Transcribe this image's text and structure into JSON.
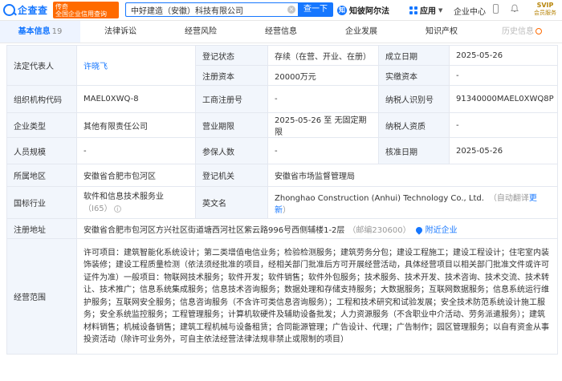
{
  "header": {
    "logo_text": "企查查",
    "brand_line1": "传奇",
    "brand_line2": "全国企业信用查询",
    "search_value": "中好建造（安徽）科技有限公司",
    "search_button": "查一下",
    "zhi_label": "知彼阿尔法",
    "app_label": "应用",
    "center_label": "企业中心",
    "svip_line1": "SVIP",
    "svip_line2": "会员服务"
  },
  "tabs": [
    {
      "label": "基本信息",
      "count": "19"
    },
    {
      "label": "法律诉讼"
    },
    {
      "label": "经营风险"
    },
    {
      "label": "经营信息"
    },
    {
      "label": "企业发展"
    },
    {
      "label": "知识产权"
    },
    {
      "label": "历史信息"
    }
  ],
  "info": {
    "legal_rep_label": "法定代表人",
    "legal_rep_value": "许晓飞",
    "reg_status_label": "登记状态",
    "reg_status_value": "存续（在营、开业、在册）",
    "est_date_label": "成立日期",
    "est_date_value": "2025-05-26",
    "reg_capital_label": "注册资本",
    "reg_capital_value": "20000万元",
    "paid_capital_label": "实缴资本",
    "paid_capital_value": "-",
    "org_code_label": "组织机构代码",
    "org_code_value": "MAEL0XWQ-8",
    "biz_reg_no_label": "工商注册号",
    "biz_reg_no_value": "-",
    "taxpayer_id_label": "纳税人识别号",
    "taxpayer_id_value": "91340000MAEL0XWQ8P",
    "company_type_label": "企业类型",
    "company_type_value": "其他有限责任公司",
    "biz_term_label": "营业期限",
    "biz_term_value": "2025-05-26 至 无固定期限",
    "taxpayer_qual_label": "纳税人资质",
    "taxpayer_qual_value": "-",
    "staff_size_label": "人员规模",
    "staff_size_value": "-",
    "insured_label": "参保人数",
    "insured_value": "-",
    "approval_date_label": "核准日期",
    "approval_date_value": "2025-05-26",
    "region_label": "所属地区",
    "region_value": "安徽省合肥市包河区",
    "reg_authority_label": "登记机关",
    "reg_authority_value": "安徽省市场监督管理局",
    "industry_label": "国标行业",
    "industry_value": "软件和信息技术服务业",
    "industry_code": "（I65）",
    "en_name_label": "英文名",
    "en_name_value": "Zhonghao Construction (Anhui) Technology Co., Ltd.",
    "en_name_auto": "（自动翻译",
    "en_name_refresh": "更新",
    "en_name_close": "）",
    "address_label": "注册地址",
    "address_value": "安徽省合肥市包河区方兴社区街道塘西河社区紫云路996号西侧辅楼1-2层",
    "address_zip": "（邮编230600）",
    "address_nearby": "附近企业",
    "scope_label": "经营范围",
    "scope_value": "许可项目：建筑智能化系统设计；第二类增值电信业务；检验检测服务；建筑劳务分包；建设工程施工；建设工程设计；住宅室内装饰装修；建设工程质量检测（依法须经批准的项目，经相关部门批准后方可开展经营活动，具体经营项目以相关部门批准文件或许可证件为准）一般项目：物联网技术服务；软件开发；软件销售；软件外包服务；技术服务、技术开发、技术咨询、技术交流、技术转让、技术推广；信息系统集成服务；信息技术咨询服务；数据处理和存储支持服务；大数据服务；互联网数据服务；信息系统运行维护服务；互联网安全服务；信息咨询服务（不含许可类信息咨询服务）；工程和技术研究和试验发展；安全技术防范系统设计施工服务；安全系统监控服务；工程管理服务；计算机软硬件及辅助设备批发；人力资源服务（不含职业中介活动、劳务派遣服务）；建筑材料销售；机械设备销售；建筑工程机械与设备租赁；合同能源管理；广告设计、代理；广告制作；园区管理服务；以自有资金从事投资活动（除许可业务外，可自主依法经营法律法规非禁止或限制的项目）"
  },
  "colors": {
    "accent": "#1677ff",
    "brand_orange": "#ff6a00",
    "label_bg": "#f2f6fc",
    "border": "#e4e8f0"
  }
}
